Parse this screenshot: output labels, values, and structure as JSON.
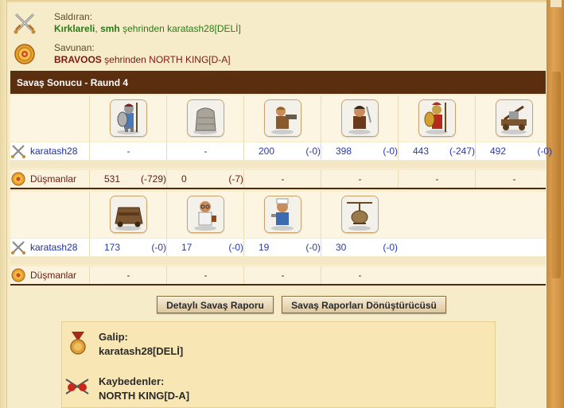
{
  "attacker": {
    "label": "Saldıran:",
    "city": "Kırklareli",
    "separator": ",",
    "player_bold": "smh",
    "rest": "şehrinden karatash28[DELİ]"
  },
  "defender": {
    "label": "Savunan:",
    "player_bold": "BRAVOOS",
    "rest": "şehrinden NORTH KING[D-A]"
  },
  "result_title": "Savaş Sonucu - Raund 4",
  "groups": [
    {
      "units": [
        "hoplite-unit",
        "wall-stone-unit",
        "slinger-unit",
        "swordsman-unit",
        "spartan-warrior-unit",
        "catapult-unit"
      ],
      "attacker": {
        "name": "karatash28",
        "cells": [
          {
            "count": "-",
            "loss": ""
          },
          {
            "count": "-",
            "loss": ""
          },
          {
            "count": "200",
            "loss": "(-0)"
          },
          {
            "count": "398",
            "loss": "(-0)"
          },
          {
            "count": "443",
            "loss": "(-247)"
          },
          {
            "count": "492",
            "loss": "(-0)"
          }
        ]
      },
      "enemy": {
        "name": "Düşmanlar",
        "cells": [
          {
            "count": "531",
            "loss": "(-729)"
          },
          {
            "count": "0",
            "loss": "(-7)"
          },
          {
            "count": "-",
            "loss": ""
          },
          {
            "count": "-",
            "loss": ""
          },
          {
            "count": "-",
            "loss": ""
          },
          {
            "count": "-",
            "loss": ""
          }
        ]
      }
    },
    {
      "units": [
        "battering-ram-unit",
        "doctor-unit",
        "cook-unit",
        "gyrocopter-unit"
      ],
      "attacker": {
        "name": "karatash28",
        "cells": [
          {
            "count": "173",
            "loss": "(-0)"
          },
          {
            "count": "17",
            "loss": "(-0)"
          },
          {
            "count": "19",
            "loss": "(-0)"
          },
          {
            "count": "30",
            "loss": "(-0)"
          }
        ]
      },
      "enemy": {
        "name": "Düşmanlar",
        "cells": [
          {
            "count": "-",
            "loss": ""
          },
          {
            "count": "-",
            "loss": ""
          },
          {
            "count": "-",
            "loss": ""
          },
          {
            "count": "-",
            "loss": ""
          }
        ]
      }
    }
  ],
  "buttons": {
    "detailed": "Detaylı Savaş Raporu",
    "converter": "Savaş Raporları Dönüştürücüsü"
  },
  "summary": {
    "winner_label": "Galip:",
    "winner": "karatash28[DELİ]",
    "losers_label": "Kaybedenler:",
    "losers": "NORTH KING[D-A]"
  },
  "colors": {
    "header_bg": "#5b2e0f",
    "attacker_green": "#2a7a16",
    "defender_maroon": "#7a1a10",
    "value_blue": "#2a3aaa"
  }
}
